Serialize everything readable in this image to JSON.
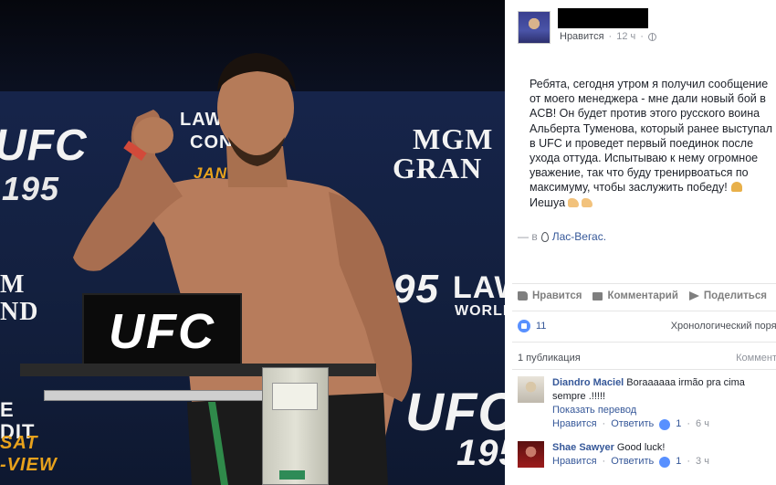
{
  "photo": {
    "signs": {
      "ufc_left": "UFC",
      "n195_left": "195",
      "law_top": "LAW",
      "con_top": "CON",
      "jan": "JAN 2",
      "mgm": "MGM",
      "grand": "GRAN",
      "m_left": "M",
      "nd_left": "ND",
      "n5_right": "95",
      "law_right": "LAW",
      "world": "WORLD",
      "ufc_right": "UFC",
      "n195_right": "195",
      "e_left": "E",
      "dit_left": "DIT",
      "sat_left": "SAT",
      "view_left": "-VIEW",
      "scale_sign": "UFC"
    }
  },
  "post": {
    "meta": {
      "like_link": "Нравится",
      "time": "12 ч"
    },
    "text_lines": [
      "Ребята, сегодня утром я получил сообщение",
      "от моего менеджера - мне дали новый бой в",
      "ACB! Он будет против этого русского воина",
      "Альберта Туменова, который ранее выступал",
      "в UFC и проведет первый поединок после",
      "ухода оттуда. Испытываю к нему огромное",
      "уважение, так что буду тренирвоаться по",
      "максимуму, чтобы заслужить победу!",
      "Иешуа"
    ],
    "location": {
      "prefix": "— в",
      "city": "Лас-Вегас."
    },
    "actions": {
      "like": "Нравится",
      "comment": "Комментарий",
      "share": "Поделиться"
    },
    "likes": {
      "count": "11",
      "order": "Хронологический поряд"
    },
    "publications": {
      "label": "1 публикация",
      "comments": "Коммента"
    }
  },
  "comments": [
    {
      "name": "Diandro Maciel",
      "text": "Boraaaaaa irmão pra cima sempre .!!!!!",
      "translate": "Показать перевод",
      "like_link": "Нравится",
      "reply_link": "Ответить",
      "likes": "1",
      "time": "6 ч"
    },
    {
      "name": "Shae Sawyer",
      "text": "Good luck!",
      "like_link": "Нравится",
      "reply_link": "Ответить",
      "likes": "1",
      "time": "3 ч"
    }
  ]
}
